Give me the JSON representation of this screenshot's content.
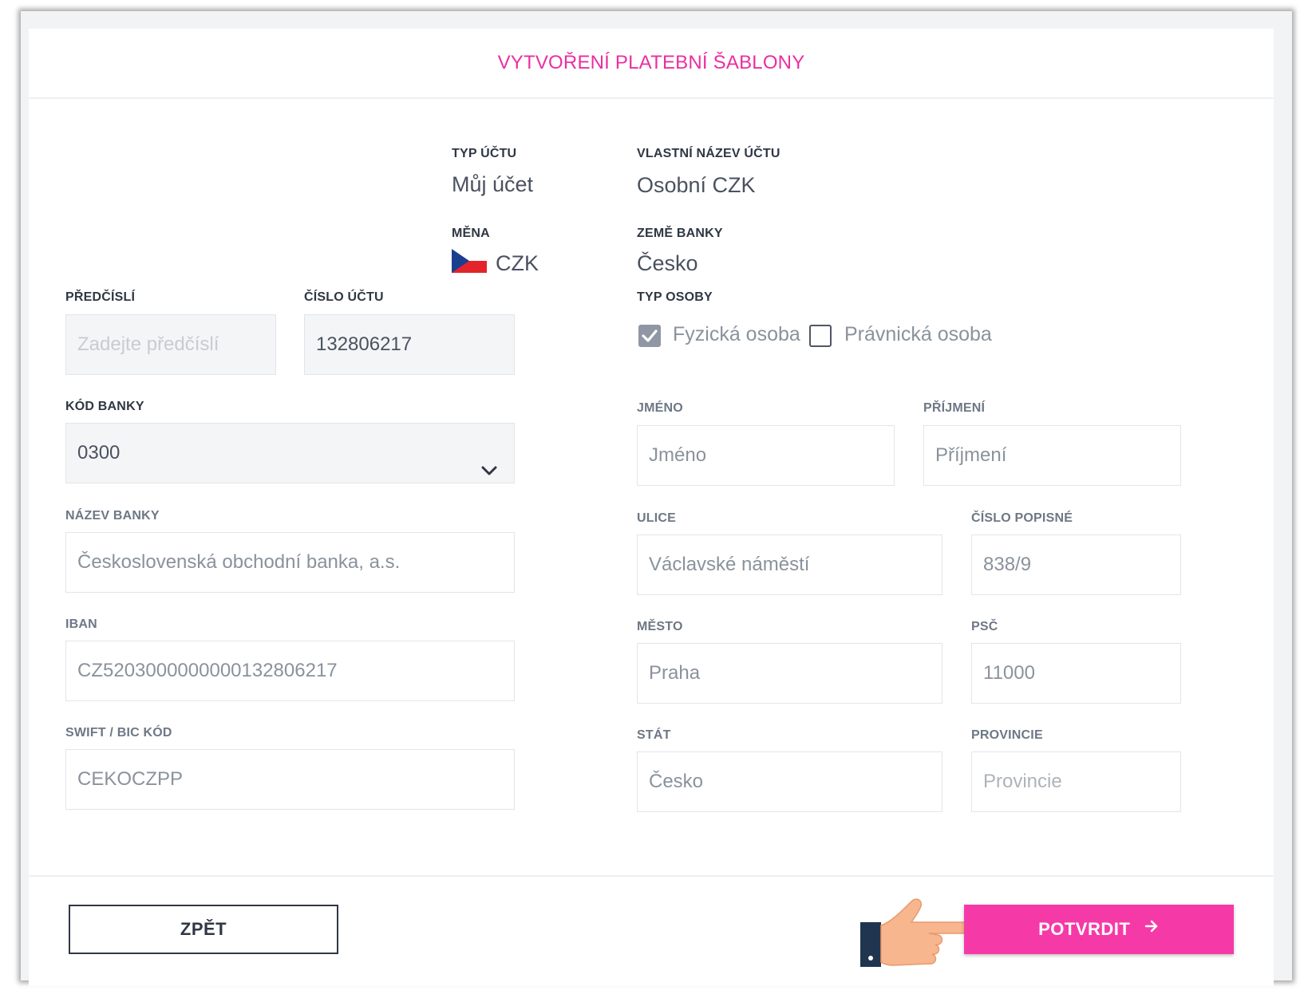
{
  "page": {
    "title": "VYTVOŘENÍ PLATEBNÍ ŠABLONY"
  },
  "account_info": {
    "type_label": "TYP ÚČTU",
    "type_value": "Můj účet",
    "name_label": "VLASTNÍ NÁZEV ÚČTU",
    "name_value": "Osobní CZK",
    "currency_label": "MĚNA",
    "currency_value": "CZK",
    "currency_flag": "czech-flag-icon",
    "country_label": "ZEMĚ BANKY",
    "country_value": "Česko"
  },
  "left_form": {
    "prefix": {
      "label": "PŘEDČÍSLÍ",
      "placeholder": "Zadejte předčíslí",
      "value": ""
    },
    "account_number": {
      "label": "ČÍSLO ÚČTU",
      "value": "132806217"
    },
    "bank_code": {
      "label": "KÓD BANKY",
      "value": "0300",
      "icon": "chevron-down-icon"
    },
    "bank_name": {
      "label": "NÁZEV BANKY",
      "value": "Československá obchodní banka, a.s."
    },
    "iban": {
      "label": "IBAN",
      "value": "CZ5203000000000132806217"
    },
    "swift": {
      "label": "SWIFT / BIC KÓD",
      "value": "CEKOCZPP"
    }
  },
  "person_type": {
    "label": "TYP OSOBY",
    "options": [
      {
        "label": "Fyzická osoba",
        "checked": true
      },
      {
        "label": "Právnická osoba",
        "checked": false
      }
    ]
  },
  "right_form": {
    "first_name": {
      "label": "JMÉNO",
      "value": "Jméno"
    },
    "last_name": {
      "label": "PŘÍJMENÍ",
      "value": "Příjmení"
    },
    "street": {
      "label": "ULICE",
      "value": "Václavské náměstí"
    },
    "house_number": {
      "label": "ČÍSLO POPISNÉ",
      "value": "838/9"
    },
    "city": {
      "label": "MĚSTO",
      "value": "Praha"
    },
    "zip": {
      "label": "PSČ",
      "value": "11000"
    },
    "state": {
      "label": "STÁT",
      "value": "Česko"
    },
    "province": {
      "label": "PROVINCIE",
      "placeholder": "Provincie",
      "value": ""
    }
  },
  "footer": {
    "back_label": "ZPĚT",
    "confirm_label": "POTVRDIT",
    "confirm_icon": "arrow-right-icon",
    "pointer_icon": "pointing-hand-icon"
  },
  "colors": {
    "accent": "#ea2fa1",
    "button": "#f53aa8",
    "text_dark": "#2f3744",
    "field_fill": "#f4f5f6",
    "hand_skin": "#f7b68d",
    "sleeve": "#1f3550"
  }
}
